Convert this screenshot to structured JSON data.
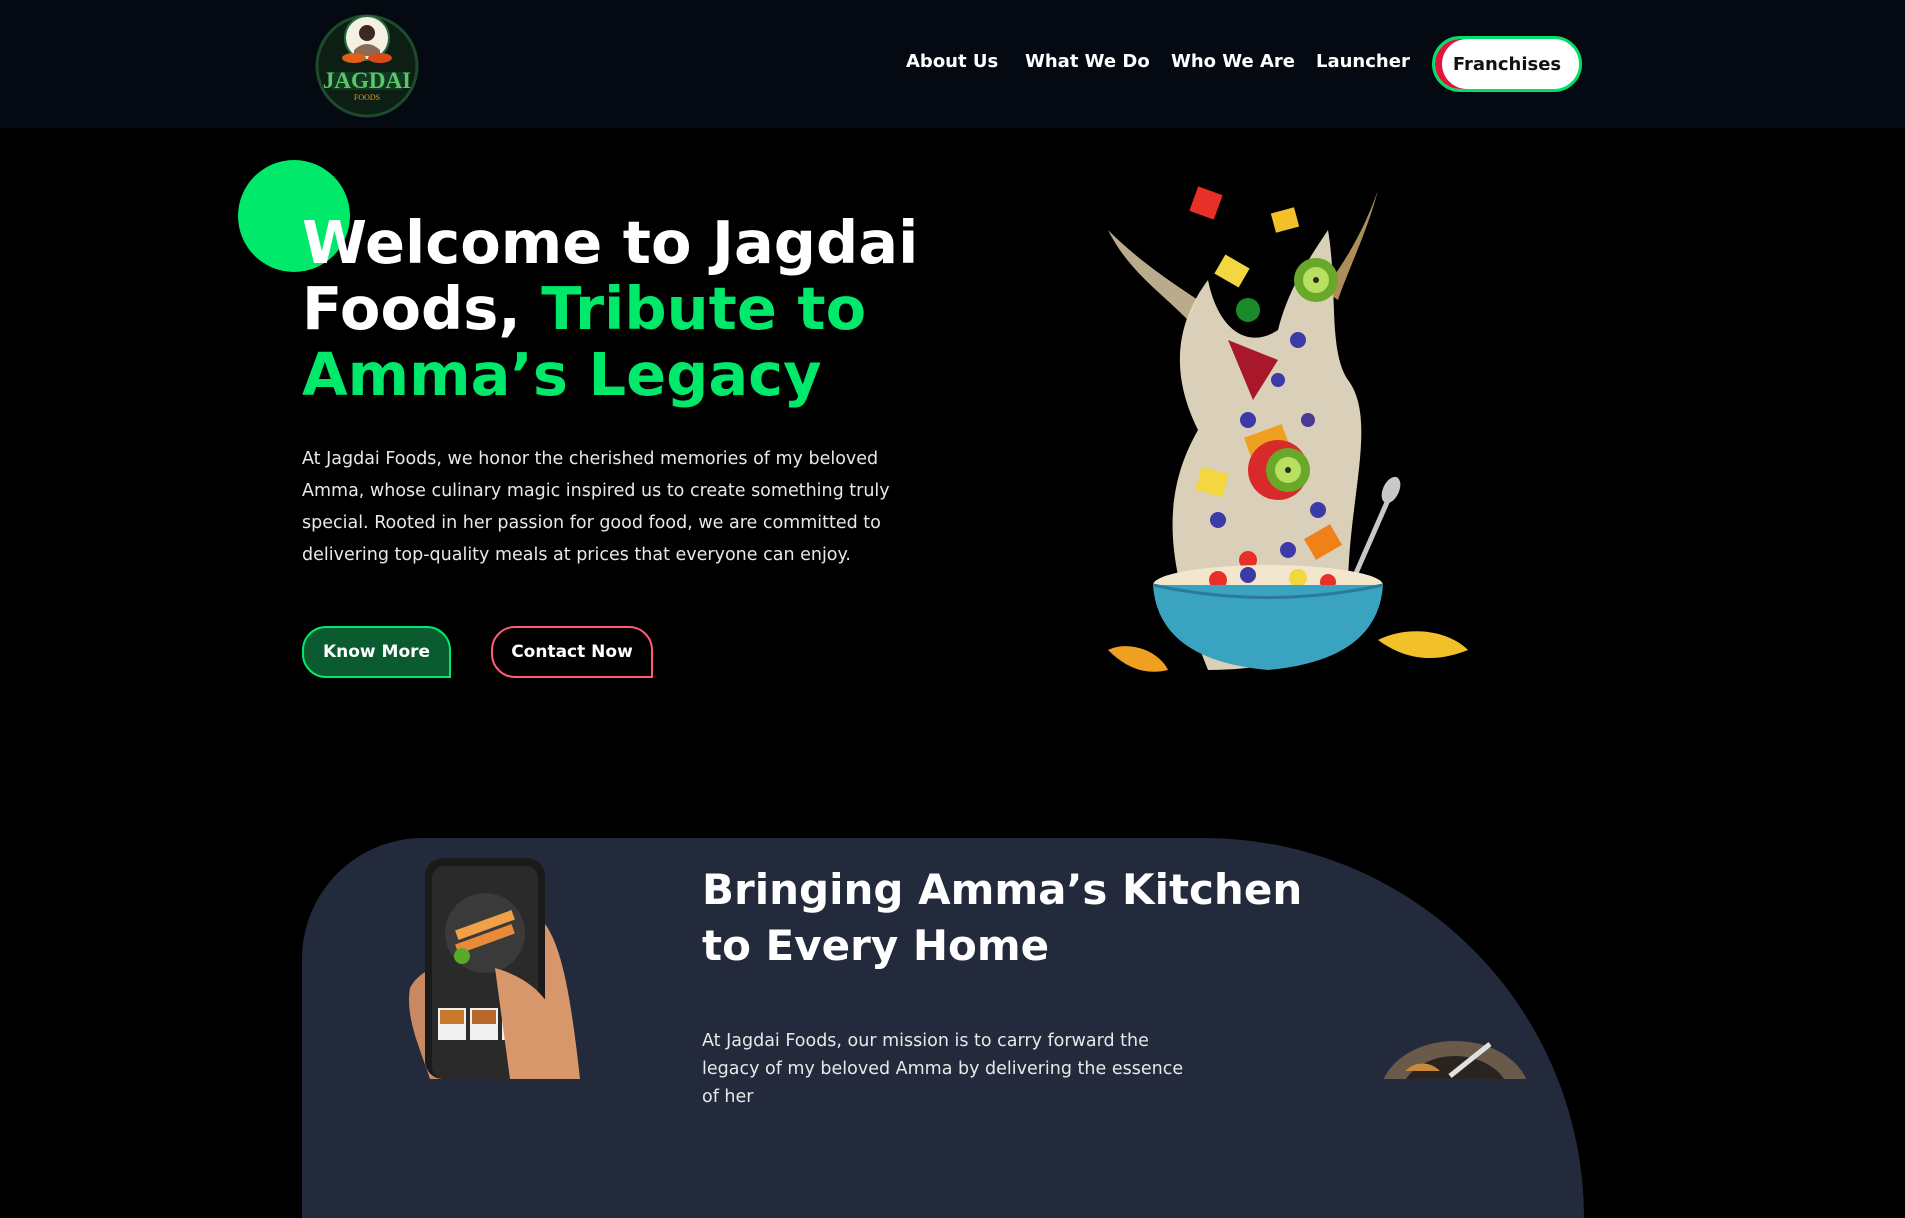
{
  "header": {
    "logo": {
      "text": "JAGDAI",
      "subtext": "FOODS"
    },
    "nav": [
      {
        "label": "About Us"
      },
      {
        "label": "What We Do"
      },
      {
        "label": "Who We Are"
      },
      {
        "label": "Launcher"
      }
    ],
    "cta_label": "Franchises"
  },
  "hero": {
    "title_white": "Welcome to Jagdai Foods,",
    "title_accent": "Tribute to Amma’s Legacy",
    "description": "At Jagdai Foods, we honor the cherished memories of my beloved Amma, whose culinary magic inspired us to create something truly special. Rooted in her passion for good food, we are committed to delivering top-quality meals at prices that everyone can enjoy.",
    "primary_button": "Know More",
    "secondary_button": "Contact Now"
  },
  "mission": {
    "title": "Bringing Amma’s Kitchen to Every Home",
    "description": "At Jagdai Foods, our mission is to carry forward the legacy of my beloved Amma by delivering the essence of her"
  },
  "colors": {
    "accent_green": "#00e96a",
    "accent_red": "#e0143c",
    "header_bg": "#050912",
    "card_bg": "#222a3c"
  }
}
